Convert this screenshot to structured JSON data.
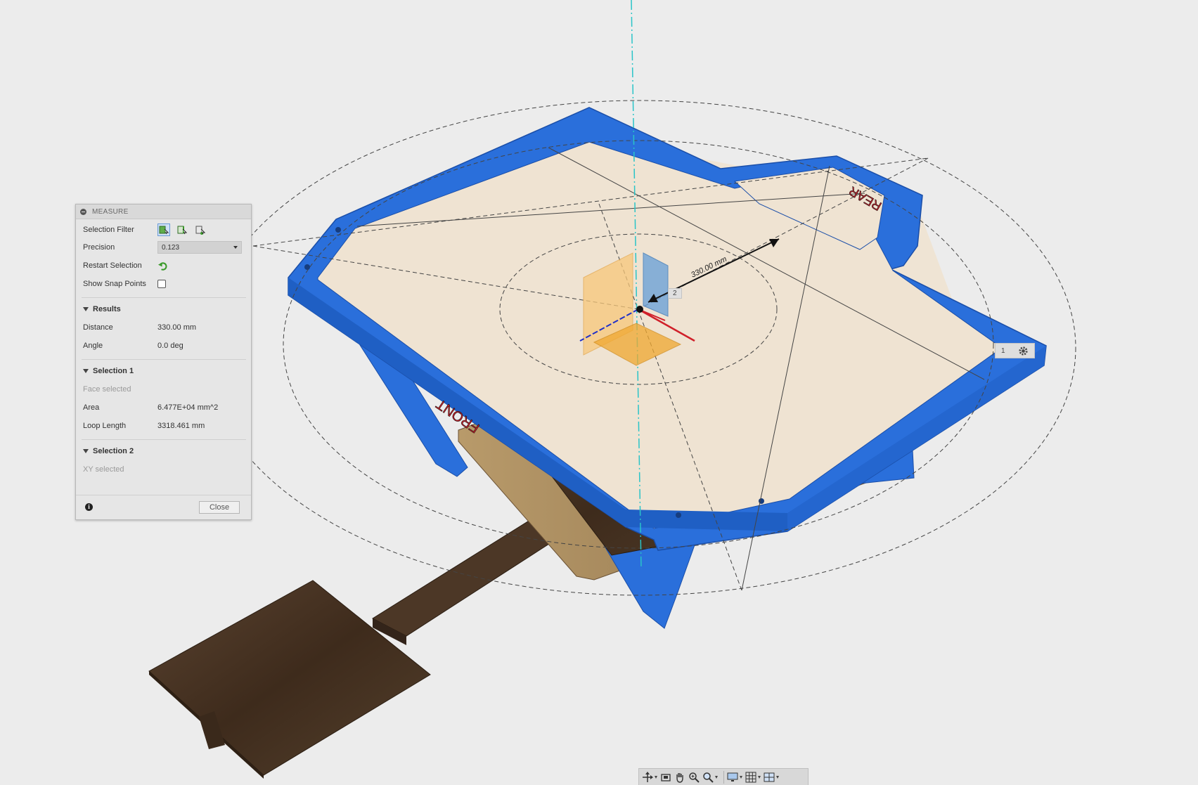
{
  "panel": {
    "title": "MEASURE",
    "selection_filter_label": "Selection Filter",
    "precision_label": "Precision",
    "precision_value": "0.123",
    "restart_label": "Restart Selection",
    "snap_label": "Show Snap Points",
    "results_title": "Results",
    "distance_label": "Distance",
    "distance_value": "330.00 mm",
    "angle_label": "Angle",
    "angle_value": "0.0 deg",
    "selection1_title": "Selection 1",
    "selection1_status": "Face selected",
    "area_label": "Area",
    "area_value": "6.477E+04 mm^2",
    "loop_label": "Loop Length",
    "loop_value": "3318.461 mm",
    "selection2_title": "Selection 2",
    "selection2_status": "XY selected",
    "close_label": "Close"
  },
  "viewport": {
    "dimension_label": "330.00 mm",
    "front_label": "FRONT",
    "rear_label": "REAR",
    "point1_label": "1",
    "point2_label": "2"
  },
  "colors": {
    "frame_blue": "#2a6fdb",
    "wood": "#4a3524",
    "accent_red": "#d0202a"
  }
}
